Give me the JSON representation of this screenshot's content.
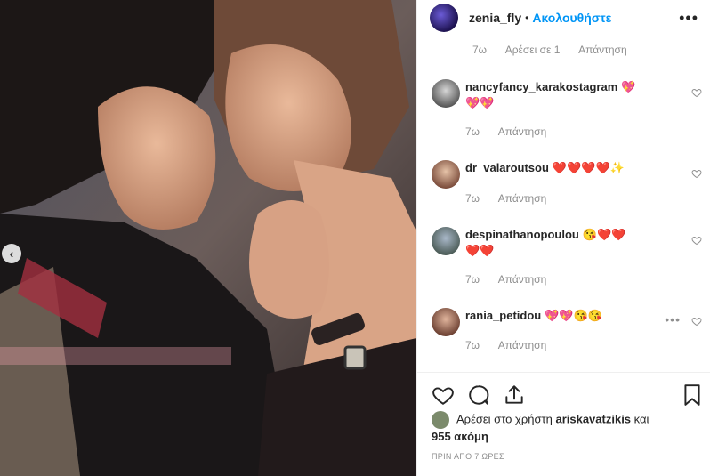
{
  "header": {
    "username": "zenia_fly",
    "separator": "•",
    "follow_label": "Ακολουθήστε",
    "more_label": "•••"
  },
  "partial_comment": {
    "time": "7ω",
    "likes": "Αρέσει σε 1",
    "reply": "Απάντηση"
  },
  "comments": [
    {
      "username": "nancyfancy_karakostagram",
      "text_line1": "💖",
      "text_line2": "💖💖",
      "time": "7ω",
      "reply": "Απάντηση"
    },
    {
      "username": "dr_valaroutsou",
      "text_line1": "❤️❤️❤️❤️✨",
      "time": "7ω",
      "reply": "Απάντηση"
    },
    {
      "username": "despinathanopoulou",
      "text_line1": "😘❤️❤️",
      "text_line2": "❤️❤️",
      "time": "7ω",
      "reply": "Απάντηση"
    },
    {
      "username": "rania_petidou",
      "text_line1": "💖💖😘😘",
      "time": "7ω",
      "reply": "Απάντηση",
      "more_label": "•••"
    }
  ],
  "likes": {
    "prefix": "Αρέσει στο χρήστη",
    "user": "ariskavatzikis",
    "suffix": "και",
    "count": "955 ακόμη"
  },
  "timeago": "ΠΡΙΝ ΑΠΟ 7 ΩΡΕΣ",
  "nav": {
    "prev_label": "‹"
  },
  "colors": {
    "accent": "#0095f6",
    "muted": "#8e8e8e",
    "heart_red": "#ed4956"
  }
}
